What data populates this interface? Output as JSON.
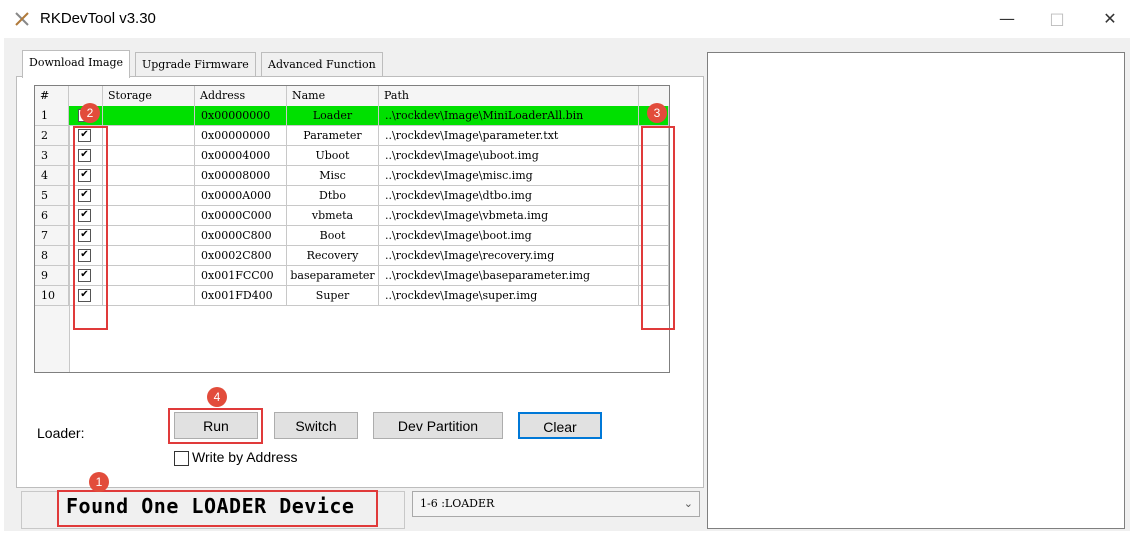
{
  "window": {
    "title": "RKDevTool v3.30",
    "minimize": "—",
    "maximize": "□",
    "close": "✕"
  },
  "tabs": [
    {
      "label": "Download Image",
      "active": true
    },
    {
      "label": "Upgrade Firmware",
      "active": false
    },
    {
      "label": "Advanced Function",
      "active": false
    }
  ],
  "table": {
    "columns": [
      "#",
      "",
      "Storage",
      "Address",
      "Name",
      "Path"
    ],
    "rows": [
      {
        "num": "1",
        "checked": true,
        "storage": "",
        "address": "0x00000000",
        "name": "Loader",
        "path": "..\\rockdev\\Image\\MiniLoaderAll.bin",
        "selected": true
      },
      {
        "num": "2",
        "checked": true,
        "storage": "",
        "address": "0x00000000",
        "name": "Parameter",
        "path": "..\\rockdev\\Image\\parameter.txt",
        "selected": false
      },
      {
        "num": "3",
        "checked": true,
        "storage": "",
        "address": "0x00004000",
        "name": "Uboot",
        "path": "..\\rockdev\\Image\\uboot.img",
        "selected": false
      },
      {
        "num": "4",
        "checked": true,
        "storage": "",
        "address": "0x00008000",
        "name": "Misc",
        "path": "..\\rockdev\\Image\\misc.img",
        "selected": false
      },
      {
        "num": "5",
        "checked": true,
        "storage": "",
        "address": "0x0000A000",
        "name": "Dtbo",
        "path": "..\\rockdev\\Image\\dtbo.img",
        "selected": false
      },
      {
        "num": "6",
        "checked": true,
        "storage": "",
        "address": "0x0000C000",
        "name": "vbmeta",
        "path": "..\\rockdev\\Image\\vbmeta.img",
        "selected": false
      },
      {
        "num": "7",
        "checked": true,
        "storage": "",
        "address": "0x0000C800",
        "name": "Boot",
        "path": "..\\rockdev\\Image\\boot.img",
        "selected": false
      },
      {
        "num": "8",
        "checked": true,
        "storage": "",
        "address": "0x0002C800",
        "name": "Recovery",
        "path": "..\\rockdev\\Image\\recovery.img",
        "selected": false
      },
      {
        "num": "9",
        "checked": true,
        "storage": "",
        "address": "0x001FCC00",
        "name": "baseparameter",
        "path": "..\\rockdev\\Image\\baseparameter.img",
        "selected": false
      },
      {
        "num": "10",
        "checked": true,
        "storage": "",
        "address": "0x001FD400",
        "name": "Super",
        "path": "..\\rockdev\\Image\\super.img",
        "selected": false
      }
    ]
  },
  "controls": {
    "loader_label": "Loader:",
    "run": "Run",
    "switch": "Switch",
    "dev_partition": "Dev Partition",
    "clear": "Clear",
    "write_by_address": "Write by Address"
  },
  "status": {
    "message": "Found One LOADER Device",
    "device_select_value": "1-6 :LOADER"
  },
  "annotations": {
    "badge_1": "1",
    "badge_2": "2",
    "badge_3": "3",
    "badge_4": "4"
  },
  "colors": {
    "selected_row": "#00e000",
    "annotation_red": "#e03a3a",
    "focus_blue": "#0078d7"
  }
}
